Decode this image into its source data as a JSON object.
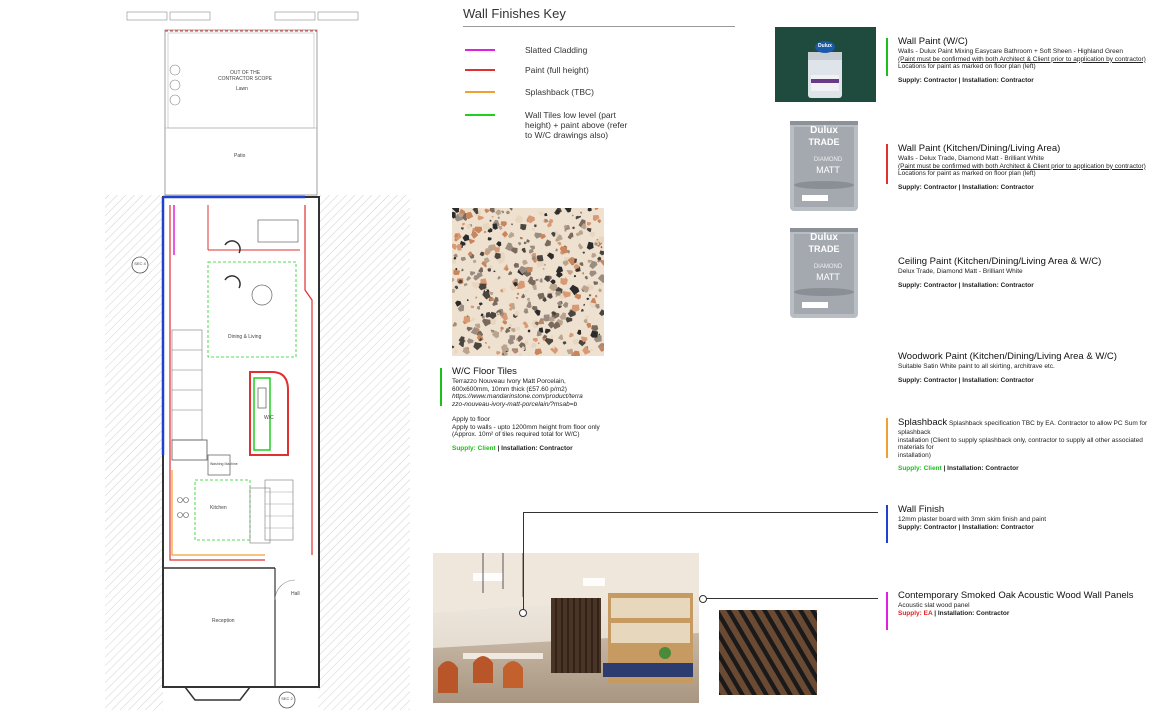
{
  "plan": {
    "scope_labels": [
      "OUT OF THE",
      "CONTRACTOR SCOPE"
    ],
    "lawn": "Lawn",
    "patio": "Patio",
    "dining": "Dining & Living",
    "wc": "W/C",
    "kitchen": "Kitchen",
    "utility": "Washing Machine",
    "hall": "Hall",
    "reception": "Reception",
    "sec_top": "SEC 4",
    "sec_bottom": "SEC 2"
  },
  "key": {
    "title": "Wall Finishes Key",
    "items": [
      {
        "label": "Slatted Cladding",
        "color": "#e020e0"
      },
      {
        "label": "Paint (full height)",
        "color": "#e03030"
      },
      {
        "label": "Splashback (TBC)",
        "color": "#f0a030"
      },
      {
        "label": "Wall Tiles low level (part height) + paint above (refer to W/C drawings also)",
        "color": "#20d020"
      }
    ]
  },
  "floor": {
    "title": "W/C Floor Tiles",
    "line1": "Terrazzo Nouveau Ivory Matt Porcelain,",
    "line2": "600x600mm, 10mm thick (£57.60 p/m2)",
    "url1": "https://www.mandarinstone.com/product/terra",
    "url2": "zzo-nouveau-ivory-matt-porcelain/?msab=b",
    "apply1": "Apply to floor",
    "apply2": "Apply to walls -  upto 1200mm height from floor only",
    "apply3": "(Approx. 10m² of tiles required total for W/C)",
    "supply": "Supply: Client",
    "install": "|  Installation: Contractor"
  },
  "specs": {
    "wc_paint": {
      "title": "Wall Paint (W/C)",
      "l1": "Walls - Dulux Paint Mixing Easycare Bathroom + Soft Sheen - Highland Green",
      "l2": "(Paint must be confirmed with both Architect & Client prior to application by contractor)",
      "l3": "Locations for paint as marked on floor plan (left)",
      "supply": "Supply: Contractor  |  Installation: Contractor",
      "color": "#1dbf1d"
    },
    "kdl_paint": {
      "title": "Wall Paint (Kitchen/Dining/Living Area)",
      "l1": "Walls - Delux Trade, Diamond Matt - Brilliant White",
      "l2": "(Paint must be confirmed with both Architect & Client prior to application by contractor)",
      "l3": "Locations for paint as marked on floor plan (left)",
      "supply": "Supply: Contractor  |  Installation: Contractor",
      "color": "#e03030"
    },
    "ceiling": {
      "title": "Ceiling Paint (Kitchen/Dining/Living Area & W/C)",
      "l1": "Delux Trade, Diamond Matt - Brilliant White",
      "supply": "Supply: Contractor  |  Installation: Contractor"
    },
    "woodwork": {
      "title": "Woodwork Paint (Kitchen/Dining/Living Area & W/C)",
      "l1": "Suitable Satin White paint to all skirting, architrave etc.",
      "supply": "Supply: Contractor  |  Installation: Contractor"
    },
    "splashback": {
      "title": "Splashback",
      "l1": "Splashback specification TBC by EA. Contractor to allow PC Sum for splashback",
      "l2": "installation (Client to supply splashback only, contractor to supply all other associated materials for",
      "l3": "installation)",
      "supply": "Supply: Client",
      "install": "|  Installation: Contractor",
      "color": "#f0a030"
    },
    "wall_finish": {
      "title": "Wall Finish",
      "l1": "12mm plaster board with 3mm skim finish and paint",
      "supply": "Supply: Contractor   |  Installation: Contractor",
      "color": "#2040d0"
    },
    "panels": {
      "title": "Contemporary Smoked Oak Acoustic Wood Wall Panels",
      "l1": "Acoustic slat wood panel",
      "supply": "Supply: EA",
      "install": "| Installation: Contractor",
      "color": "#e020e0"
    }
  },
  "tins": {
    "brand_small": "Dulux",
    "brand": "Dulux",
    "trade": "TRADE",
    "product1": "DIAMOND",
    "product2": "MATT"
  }
}
